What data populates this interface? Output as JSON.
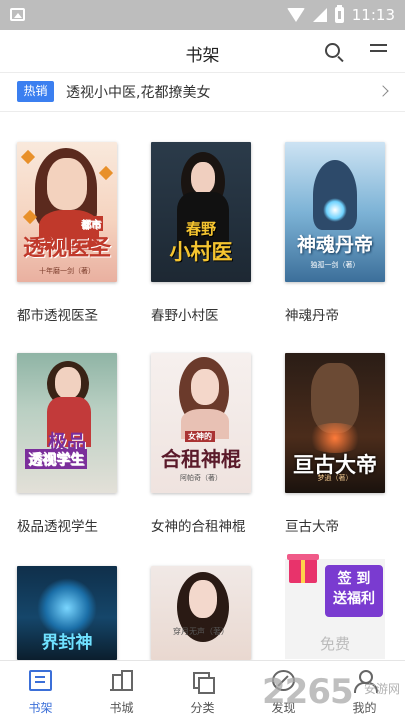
{
  "status_bar": {
    "time": "11:13"
  },
  "header": {
    "title": "书架"
  },
  "promo": {
    "badge": "热销",
    "text": "透视小中医,花都撩美女"
  },
  "books": [
    {
      "name": "都市透视医圣",
      "cover_title": "透视医圣",
      "cover_sub": "十年磨一剑（著）",
      "cover_tag": "都市"
    },
    {
      "name": "春野小村医",
      "cover_title": "小村医",
      "cover_tag": "春野"
    },
    {
      "name": "神魂丹帝",
      "cover_title": "神魂丹帝",
      "cover_sub": "独孤一剑（著）"
    },
    {
      "name": "极品透视学生",
      "cover_title": "透视学生",
      "cover_tag": "极品"
    },
    {
      "name": "女神的合租神棍",
      "cover_title": "合租神棍",
      "cover_tag": "女神的",
      "cover_sub": "阿帕奇（著）"
    },
    {
      "name": "亘古大帝",
      "cover_title": "亘古大帝",
      "cover_sub": "梦逍（著）"
    },
    {
      "cover_title": "界封神"
    },
    {
      "cover_sub": "穿月无声（著）"
    }
  ],
  "signin_card": {
    "line1": "签 到",
    "line2": "送福利",
    "free_text": "免费"
  },
  "bottom_nav": [
    {
      "label": "书架",
      "icon": "bookshelf-icon",
      "active": true
    },
    {
      "label": "书城",
      "icon": "bookstore-icon",
      "active": false
    },
    {
      "label": "分类",
      "icon": "category-icon",
      "active": false
    },
    {
      "label": "发现",
      "icon": "discover-icon",
      "active": false
    },
    {
      "label": "我的",
      "icon": "profile-icon",
      "active": false
    }
  ],
  "watermark": {
    "number": "2265",
    "site": "安游网"
  },
  "colors": {
    "accent": "#3b6fd8",
    "badge": "#3b7ff0",
    "signin": "#7a3bd0"
  }
}
